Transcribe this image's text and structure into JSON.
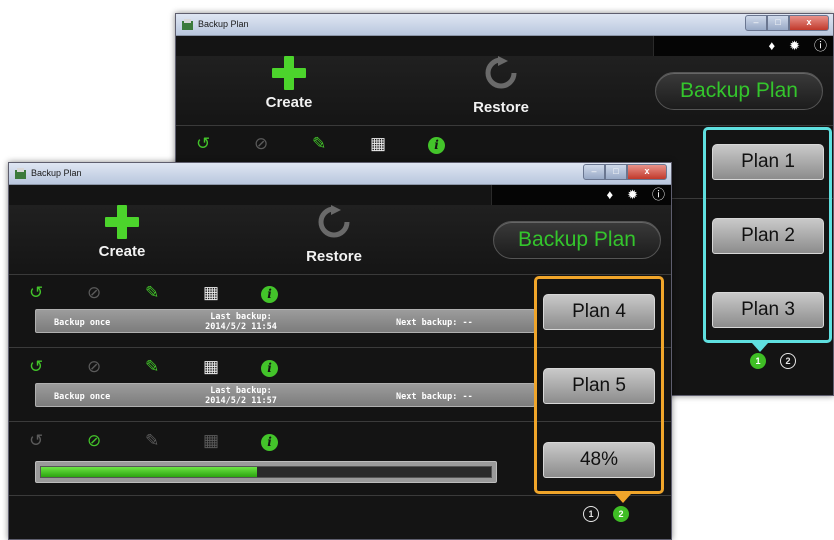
{
  "back_window": {
    "title": "Backup Plan",
    "window_buttons": {
      "minimize": "–",
      "maximize": "□",
      "close": "x"
    },
    "top_icons": [
      "tag-icon",
      "gear-icon",
      "info-icon"
    ],
    "create_label": "Create",
    "restore_label": "Restore",
    "brand": "Backup Plan",
    "plan_tabs": [
      "Plan 1",
      "Plan 2",
      "Plan 3"
    ],
    "pager": [
      "1",
      "2"
    ],
    "pager_active": 1,
    "highlight_color": "#5fe0e0"
  },
  "front_window": {
    "title": "Backup Plan",
    "window_buttons": {
      "minimize": "–",
      "maximize": "□",
      "close": "x"
    },
    "create_label": "Create",
    "restore_label": "Restore",
    "brand": "Backup Plan",
    "rows": [
      {
        "mode": "Backup once",
        "last_label": "Last backup:",
        "last_value": "2014/5/2 11:54",
        "next": "Next backup: --",
        "plan": "Plan 4"
      },
      {
        "mode": "Backup once",
        "last_label": "Last backup:",
        "last_value": "2014/5/2 11:57",
        "next": "Next backup: --",
        "plan": "Plan 5"
      }
    ],
    "progress_row": {
      "percent_label": "48%",
      "progress": 0.48
    },
    "pager": [
      "1",
      "2"
    ],
    "pager_active": 1,
    "highlight_color": "#f0a52a"
  },
  "colors": {
    "accent_green": "#43c42a",
    "brand_green": "#34c52c"
  }
}
